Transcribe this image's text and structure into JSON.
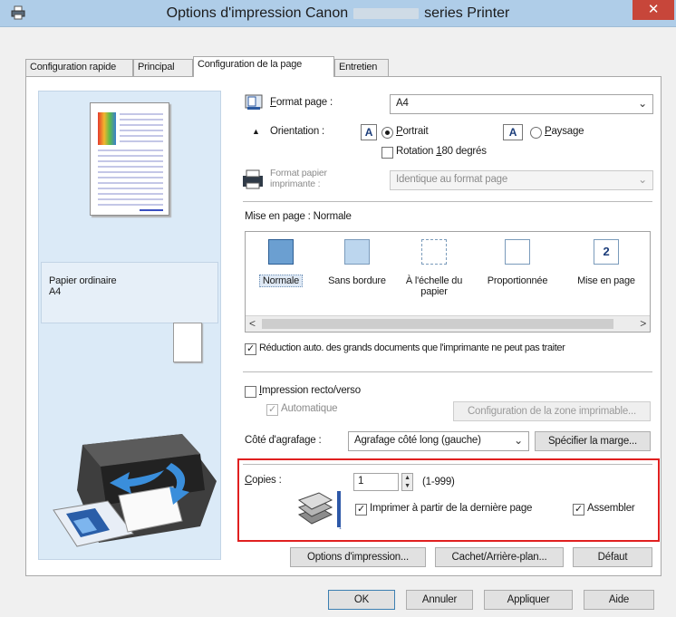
{
  "window": {
    "title_prefix": "Options d'impression Canon",
    "title_suffix": "series Printer",
    "close_glyph": "✕"
  },
  "tabs": [
    {
      "label": "Configuration rapide",
      "active": false
    },
    {
      "label": "Principal",
      "active": false
    },
    {
      "label": "Configuration de la page",
      "active": true
    },
    {
      "label": "Entretien",
      "active": false
    }
  ],
  "preview": {
    "paper_type": "Papier ordinaire",
    "paper_size": "A4"
  },
  "page_setup": {
    "format_label_pre": "",
    "format_label_u": "F",
    "format_label_post": "ormat page :",
    "format_value": "A4",
    "orientation_label": "Orientation :",
    "portrait_pre": "",
    "portrait_u": "P",
    "portrait_post": "ortrait",
    "landscape_pre": "",
    "landscape_u": "P",
    "landscape_post": "aysage",
    "orientation_icon_glyph": "A",
    "rotation_pre": "Rotation ",
    "rotation_u": "1",
    "rotation_post": "80 degrés",
    "printer_paper_label_1": "Format papier",
    "printer_paper_label_2": "imprimante :",
    "printer_paper_value": "Identique au format page"
  },
  "layout": {
    "label": "Mise en page :",
    "current": "Normale",
    "items": [
      {
        "label": "Normale",
        "selected": true
      },
      {
        "label": "Sans bordure",
        "selected": false
      },
      {
        "label": "À l'échelle du papier",
        "selected": false
      },
      {
        "label": "Proportionnée",
        "selected": false
      },
      {
        "label": "Mise en page",
        "selected": false
      }
    ],
    "scroll_left": "<",
    "scroll_right": ">"
  },
  "auto_reduce": {
    "label": "Réduction auto. des grands documents que l'imprimante ne peut pas traiter",
    "checked": true
  },
  "duplex": {
    "label_pre": "",
    "label_u": "I",
    "label_post": "mpression recto/verso",
    "checked": false,
    "automatic_label": "Automatique",
    "automatic_checked": true,
    "printable_area_button": "Configuration de la zone imprimable..."
  },
  "stapling": {
    "label": "Côté d'agrafage :",
    "value": "Agrafage côté long (gauche)",
    "margin_button": "Spécifier la marge..."
  },
  "copies": {
    "label_pre": "",
    "label_u": "C",
    "label_post": "opies :",
    "value": "1",
    "range": "(1-999)",
    "reverse_label": "Imprimer à partir de la dernière page",
    "reverse_checked": true,
    "collate_label": "Assembler",
    "collate_checked": true
  },
  "action_buttons": {
    "print_options": "Options d'impression...",
    "stamp": "Cachet/Arrière-plan...",
    "defaults": "Défaut"
  },
  "dialog_buttons": {
    "ok": "OK",
    "cancel": "Annuler",
    "apply": "Appliquer",
    "help": "Aide"
  },
  "colors": {
    "titlebar": "#afcde8",
    "close": "#c7463a",
    "highlight": "#e02020",
    "preview_bg": "#dbeaf7"
  }
}
